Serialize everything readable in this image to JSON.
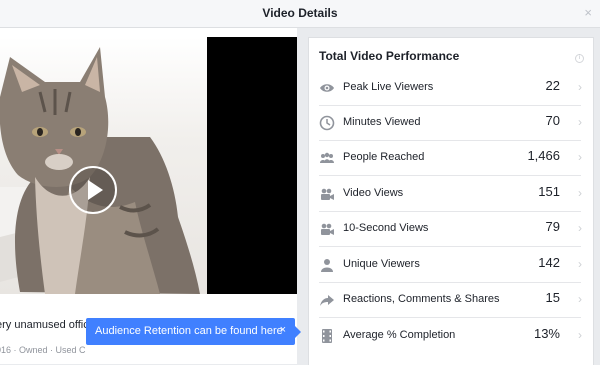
{
  "header": {
    "title": "Video Details",
    "close": "×"
  },
  "video": {
    "description": "ery unamused office assistant...",
    "meta": "016 · Owned · Used C"
  },
  "tooltip": {
    "text": "Audience Retention can be found here",
    "close": "×"
  },
  "panel": {
    "title": "Total Video Performance",
    "metrics": [
      {
        "icon": "eye-icon",
        "label": "Peak Live Viewers",
        "value": "22"
      },
      {
        "icon": "clock-icon",
        "label": "Minutes Viewed",
        "value": "70"
      },
      {
        "icon": "people-icon",
        "label": "People Reached",
        "value": "1,466"
      },
      {
        "icon": "video-camera-icon",
        "label": "Video Views",
        "value": "151"
      },
      {
        "icon": "video-camera-icon",
        "label": "10-Second Views",
        "value": "79"
      },
      {
        "icon": "person-icon",
        "label": "Unique Viewers",
        "value": "142"
      },
      {
        "icon": "share-icon",
        "label": "Reactions, Comments & Shares",
        "value": "15"
      },
      {
        "icon": "film-icon",
        "label": "Average % Completion",
        "value": "13%"
      }
    ]
  },
  "colors": {
    "accent": "#4080ff",
    "icon": "#90949c",
    "divider": "#e5e6e9"
  }
}
